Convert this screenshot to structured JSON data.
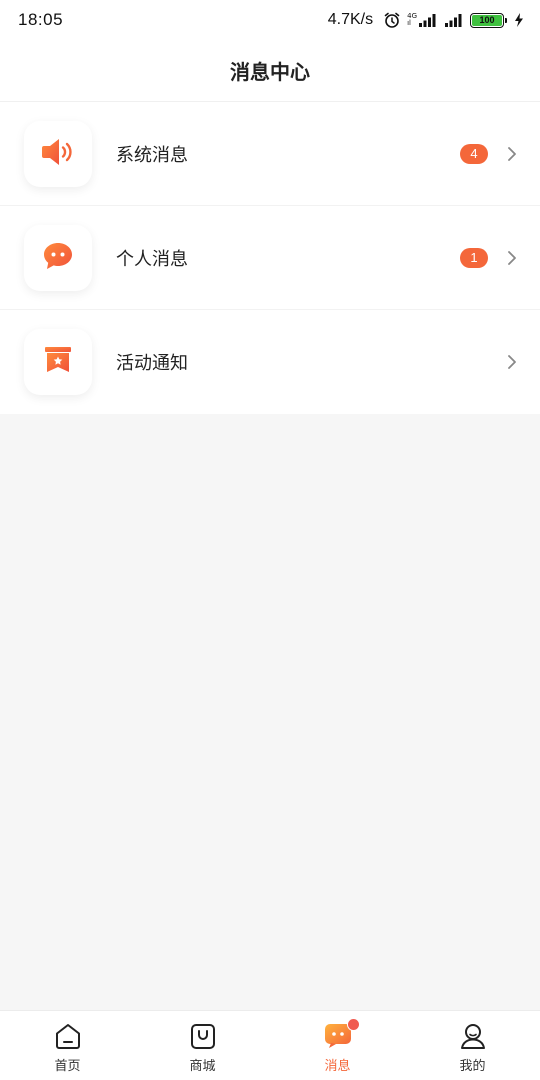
{
  "status_bar": {
    "time": "18:05",
    "net_speed": "4.7K/s",
    "net_type_top": "4G",
    "net_type_bottom": "ıl",
    "battery": "100",
    "icons": [
      "alarm-icon",
      "signal-icon",
      "signal-icon",
      "battery-icon",
      "charging-icon"
    ]
  },
  "header": {
    "title": "消息中心"
  },
  "messages": [
    {
      "label": "系统消息",
      "badge": "4",
      "icon": "speaker-icon"
    },
    {
      "label": "个人消息",
      "badge": "1",
      "icon": "chat-bubble-icon"
    },
    {
      "label": "活动通知",
      "badge": "",
      "icon": "activity-flag-icon"
    }
  ],
  "tabs": [
    {
      "label": "首页",
      "icon": "home-icon",
      "active": false
    },
    {
      "label": "商城",
      "icon": "shopping-bag-icon",
      "active": false
    },
    {
      "label": "消息",
      "icon": "message-icon",
      "active": true
    },
    {
      "label": "我的",
      "icon": "user-icon",
      "active": false
    }
  ],
  "colors": {
    "accent": "#f4673a",
    "icon_gradient_start": "#ff8a3d",
    "icon_gradient_end": "#f0513a",
    "badge": "#f4673a",
    "dot": "#f05a50"
  }
}
